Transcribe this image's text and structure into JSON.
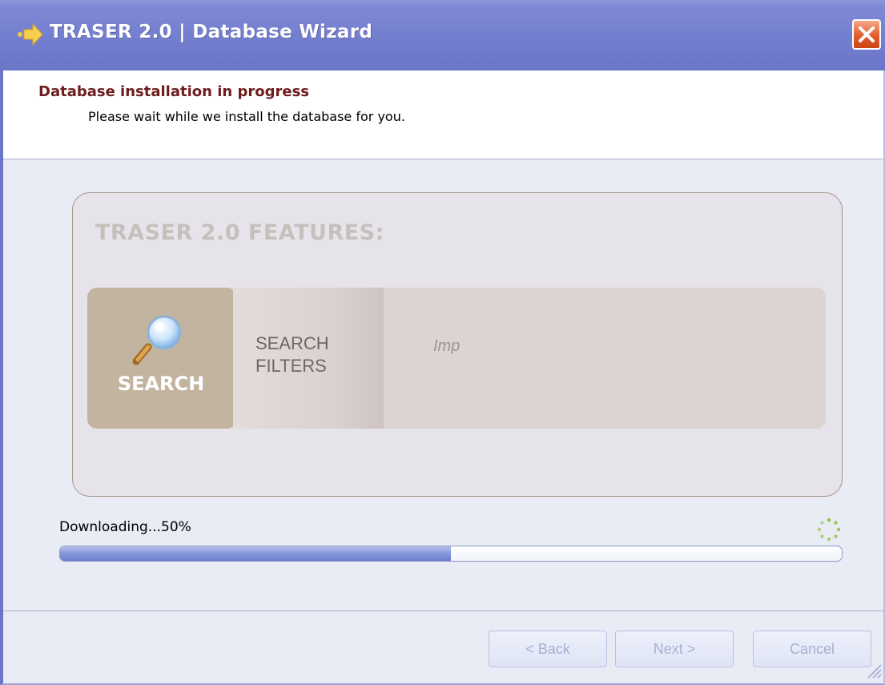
{
  "window": {
    "title": "TRASER 2.0 | Database Wizard",
    "icons": {
      "app": "arrow-icon",
      "close": "close-icon"
    }
  },
  "header": {
    "title": "Database installation in progress",
    "subtitle": "Please wait while we install the database for you."
  },
  "features": {
    "heading": "TRASER 2.0 FEATURES:",
    "tiles": [
      {
        "label": "SEARCH",
        "icon": "magnifier-icon",
        "active": true
      },
      {
        "label": "SEARCH\nFILTERS",
        "active": false
      },
      {
        "label": "Imp",
        "active": false
      }
    ]
  },
  "progress": {
    "label": "Downloading...50%",
    "value": 0.5,
    "spinner_icon": "loading-spinner-icon"
  },
  "buttons": {
    "back": "< Back",
    "next": "Next >",
    "cancel": "Cancel"
  },
  "colors": {
    "titlebar": "#747fcf",
    "header_title": "#6e1c1c",
    "progress_fill": "#8a99dc",
    "close_button": "#e05c2b"
  }
}
